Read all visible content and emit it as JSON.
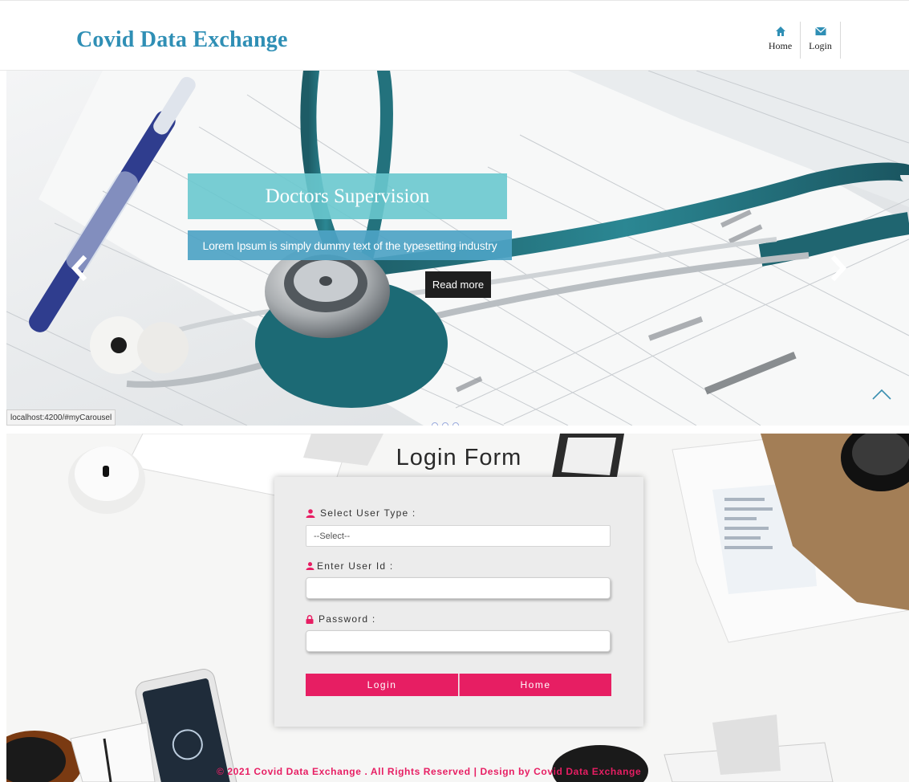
{
  "header": {
    "brand": "Covid Data Exchange",
    "nav": [
      {
        "label": "Home",
        "icon": "home-icon"
      },
      {
        "label": "Login",
        "icon": "envelope-icon"
      }
    ]
  },
  "carousel": {
    "title": "Doctors Supervision",
    "description": "Lorem Ipsum is simply dummy text of the typesetting industry",
    "read_more": "Read more",
    "status_url": "localhost:4200/#myCarousel"
  },
  "login": {
    "title": "Login Form",
    "user_type_label": "Select User Type :",
    "user_type_value": "--Select--",
    "user_id_label": "Enter User Id :",
    "password_label": "Password :",
    "login_button": "Login",
    "home_button": "Home"
  },
  "footer": {
    "text": "© 2021 Covid Data Exchange . All Rights Reserved | Design by Covid Data Exchange"
  },
  "colors": {
    "brand": "#2f8fb5",
    "accent": "#e71e63",
    "title_box": "#69c8ce",
    "desc_box": "#4da3c4"
  }
}
